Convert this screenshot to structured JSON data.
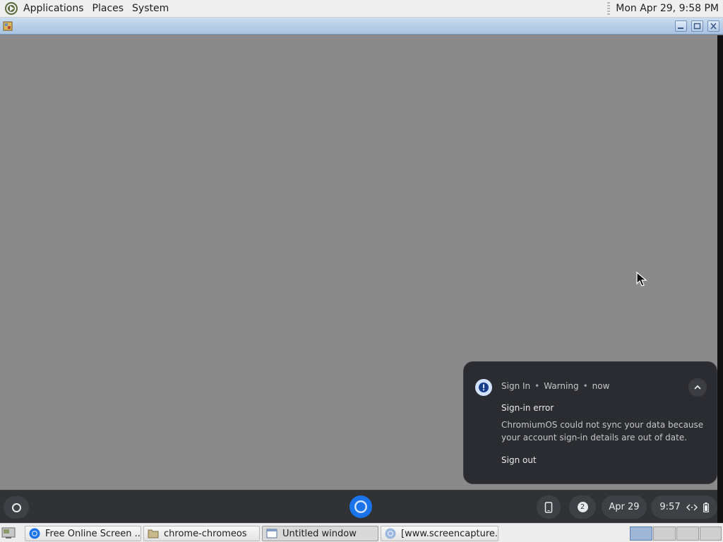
{
  "top_panel": {
    "menus": [
      "Applications",
      "Places",
      "System"
    ],
    "clock": "Mon Apr 29,  9:58 PM"
  },
  "titlebar": {
    "icons": {
      "app": "app-icon",
      "minimize": "minimize-icon",
      "maximize": "maximize-icon",
      "close": "close-icon"
    }
  },
  "notification": {
    "source": "Sign In",
    "severity": "Warning",
    "time": "now",
    "title": "Sign-in error",
    "body": "ChromiumOS could not sync your data because your account sign-in details are out of date.",
    "action": "Sign out",
    "icon": "warning-icon"
  },
  "shelf": {
    "notification_count": "2",
    "date": "Apr 29",
    "time": "9:57"
  },
  "taskbar": {
    "tasks": [
      {
        "label": "Free Online Screen ...",
        "icon": "chromium-icon"
      },
      {
        "label": "chrome-chromeos",
        "icon": "folder-icon"
      },
      {
        "label": "Untitled window",
        "icon": "window-icon"
      },
      {
        "label": "[www.screencapture...",
        "icon": "chromium-icon"
      }
    ]
  },
  "colors": {
    "desktop": "#8a8a8a",
    "notification_bg": "#2b2c31",
    "shelf_bg": "#303236",
    "chromium_blue": "#1a73e8"
  }
}
